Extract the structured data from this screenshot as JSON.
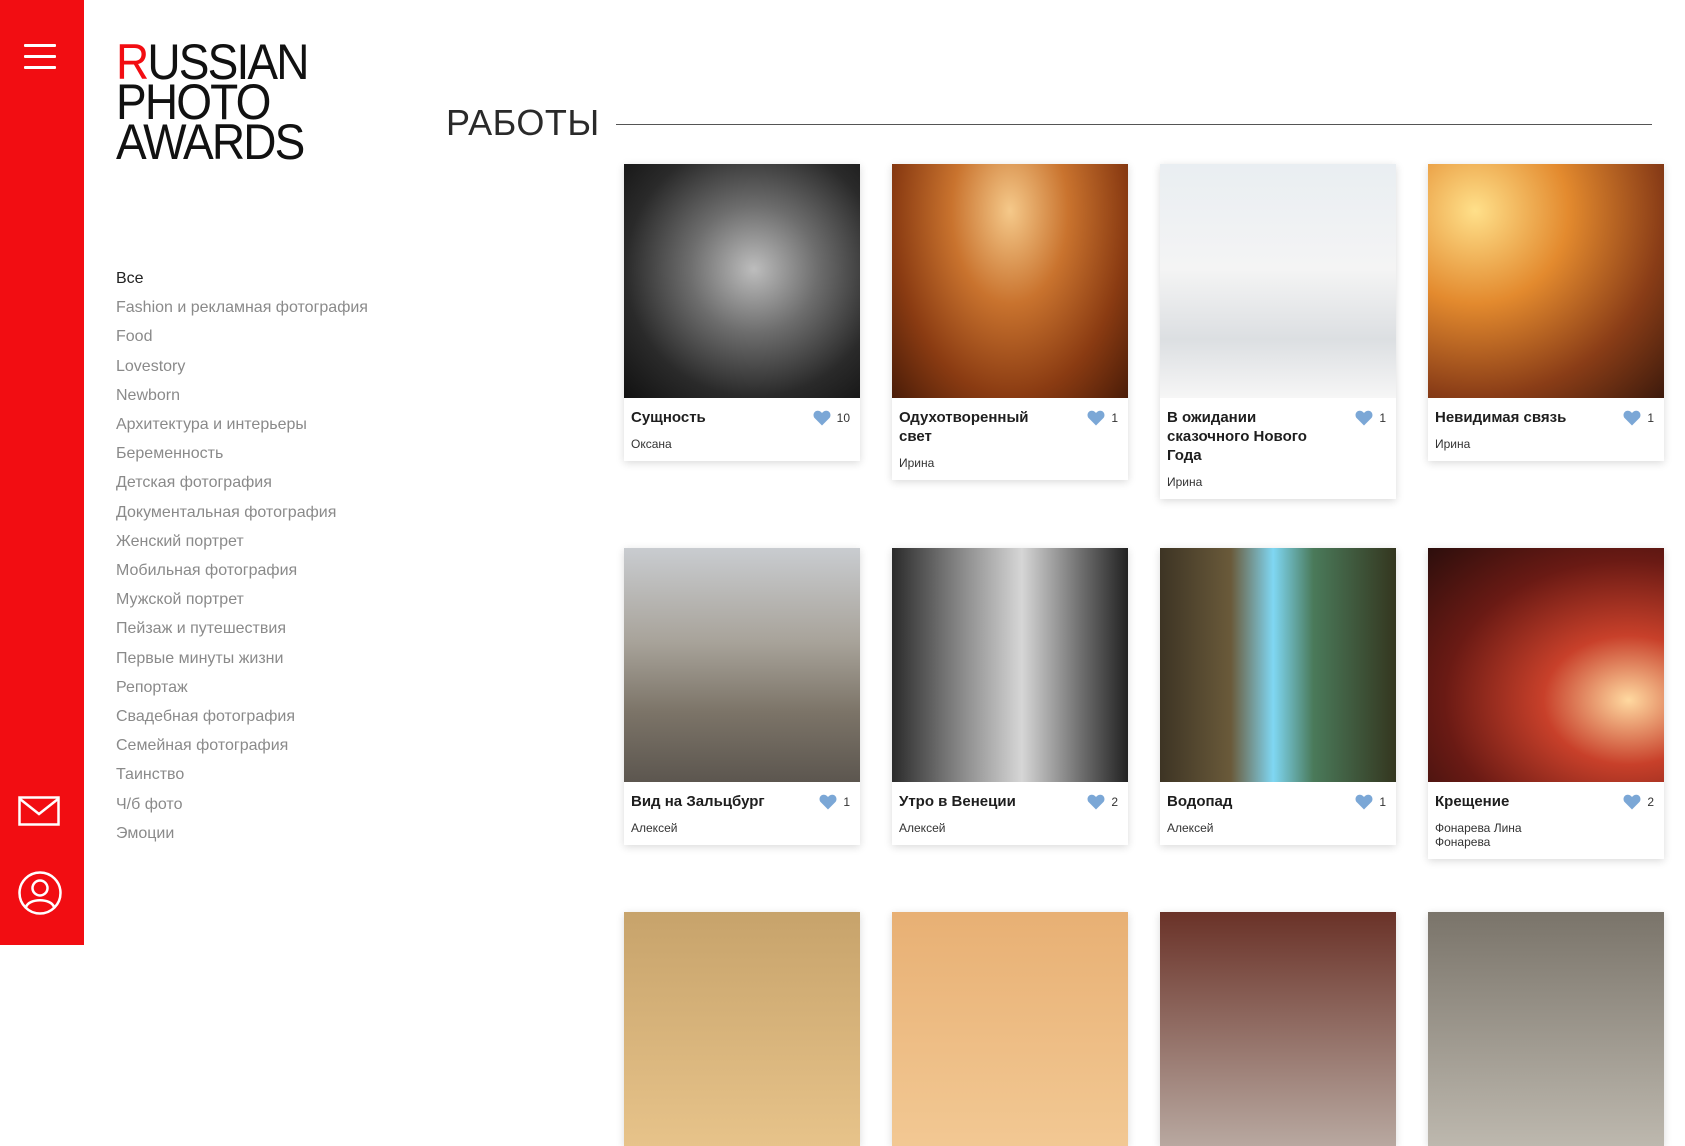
{
  "logo": {
    "first_letter": "R",
    "line1_rest": "USSIAN",
    "line2": "PHOTO",
    "line3": "AWARDS"
  },
  "page_title": "РАБОТЫ",
  "categories": [
    "Все",
    "Fashion и рекламная фотография",
    "Food",
    "Lovestory",
    "Newborn",
    "Архитектура и интерьеры",
    "Беременность",
    "Детская фотография",
    "Документальная фотография",
    "Женский портрет",
    "Мобильная фотография",
    "Мужской портрет",
    "Пейзаж и путешествия",
    "Первые минуты жизни",
    "Репортаж",
    "Свадебная фотография",
    "Семейная фотография",
    "Таинство",
    "Ч/б фото",
    "Эмоции"
  ],
  "works": [
    {
      "title": "Сущность",
      "author": "Оксана",
      "likes": "10"
    },
    {
      "title": "Одухотворенный свет",
      "author": "Ирина",
      "likes": "1"
    },
    {
      "title": "В ожидании сказочного Нового Года",
      "author": "Ирина",
      "likes": "1"
    },
    {
      "title": "Невидимая связь",
      "author": "Ирина",
      "likes": "1"
    },
    {
      "title": "Вид на Зальцбург",
      "author": "Алексей",
      "likes": "1"
    },
    {
      "title": "Утро в Венеции",
      "author": "Алексей",
      "likes": "2"
    },
    {
      "title": "Водопад",
      "author": "Алексей",
      "likes": "1"
    },
    {
      "title": "Крещение",
      "author": "Фонарева Лина Фонарева",
      "likes": "2"
    }
  ],
  "colors": {
    "brand_red": "#f20d12",
    "heart": "#7ba7d6"
  },
  "icons": {
    "menu": "hamburger-icon",
    "mail": "mail-icon",
    "user": "user-icon",
    "like": "heart-icon"
  }
}
